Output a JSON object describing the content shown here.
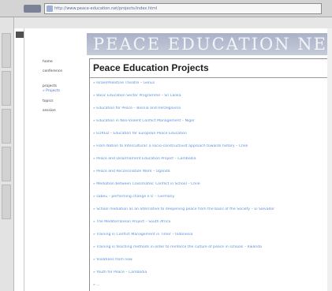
{
  "browser": {
    "address_url": "http://www.peace-education.net/projects/index.html"
  },
  "site": {
    "banner_title": "PEACE EDUCATION NET"
  },
  "nav": {
    "home": "home",
    "conference": "conference",
    "projects": "projects",
    "projects_sub": "» Projects",
    "topics": "topics",
    "session": "session"
  },
  "page": {
    "title": "Peace Education Projects"
  },
  "projects": [
    "» Israel/Palestine Theatre – Genus",
    "» Basic Education Sector Programme – Sri Lanka",
    "» Education for Peace – Bosnia and Herzegovina",
    "» Education in Non-Violent Conflict Management – Niger",
    "» EURED – Education for European Peace Education",
    "» From Nation to Intercultural: a socio-constructivist approach towards history – Chile",
    "» Peace and Disarmament Education Project – Cambodia",
    "» Peace and Reconciliation Work – Uganda",
    "» Mediation between Classmates: Conflict in School – Chile",
    "» sabeu – performing change e.V. – Germany",
    "» School mediation as an alternative to deepening peace from the basis of the Society – El Salvador",
    "» The Mediterranean Project – South Africa",
    "» Training in Conflict Management in Timor – Indonesia",
    "» Training in teaching methods in order to reinforce the culture of peace in schools – Rwanda",
    "» Violations from now",
    "» Youth for Peace – Cambodia",
    "» ..."
  ]
}
